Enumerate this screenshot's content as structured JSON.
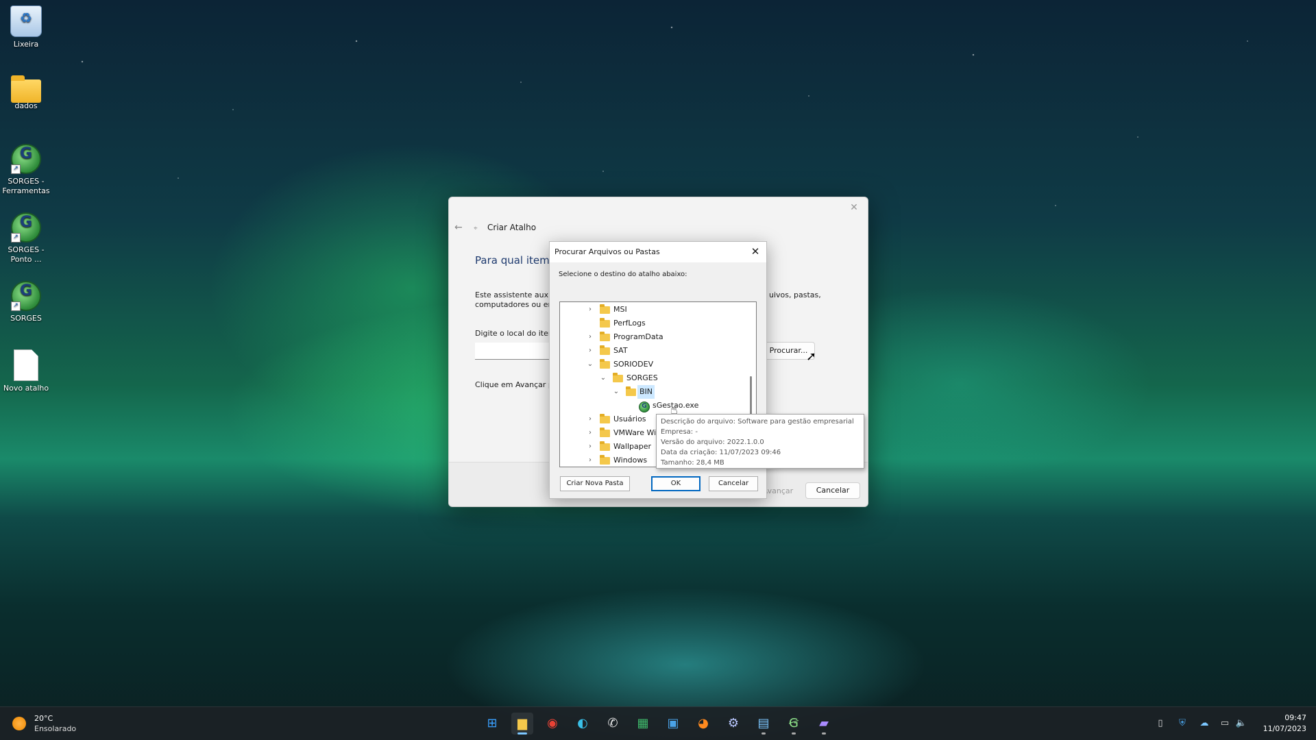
{
  "desktop": {
    "icons": [
      {
        "label": "Lixeira"
      },
      {
        "label": "dados"
      },
      {
        "label": "SORGES - Ferramentas"
      },
      {
        "label": "SORGES - Ponto ..."
      },
      {
        "label": "SORGES"
      },
      {
        "label": "Novo atalho"
      }
    ]
  },
  "wizard": {
    "title": "Criar Atalho",
    "heading": "Para qual item v",
    "description": "Este assistente auxili\ncomputadores ou en",
    "description_right": "uivos, pastas,",
    "location_label": "Digite o local do iten",
    "location_value": "",
    "browse_label": "Procurar...",
    "instruction": "Clique em Avançar p",
    "next_label": "Avançar",
    "cancel_label": "Cancelar"
  },
  "browse_dialog": {
    "title": "Procurar Arquivos ou Pastas",
    "prompt": "Selecione o destino do atalho abaixo:",
    "tree": [
      {
        "label": "MSI",
        "indent": 0,
        "expander": "collapsed",
        "type": "folder"
      },
      {
        "label": "PerfLogs",
        "indent": 0,
        "expander": "none",
        "type": "folder"
      },
      {
        "label": "ProgramData",
        "indent": 0,
        "expander": "collapsed",
        "type": "folder"
      },
      {
        "label": "SAT",
        "indent": 0,
        "expander": "collapsed",
        "type": "folder"
      },
      {
        "label": "SORIODEV",
        "indent": 0,
        "expander": "expanded",
        "type": "folder"
      },
      {
        "label": "SORGES",
        "indent": 1,
        "expander": "expanded",
        "type": "folder"
      },
      {
        "label": "BIN",
        "indent": 2,
        "expander": "expanded",
        "type": "folder",
        "selected": true
      },
      {
        "label": "sGestao.exe",
        "indent": 3,
        "expander": "none",
        "type": "exe"
      },
      {
        "label": "Usuários",
        "indent": 0,
        "expander": "collapsed",
        "type": "folder"
      },
      {
        "label": "VMWare Wi",
        "indent": 0,
        "expander": "collapsed",
        "type": "folder"
      },
      {
        "label": "Wallpaper",
        "indent": 0,
        "expander": "collapsed",
        "type": "folder"
      },
      {
        "label": "Windows",
        "indent": 0,
        "expander": "collapsed",
        "type": "folder"
      }
    ],
    "new_folder_label": "Criar Nova Pasta",
    "ok_label": "OK",
    "cancel_label": "Cancelar"
  },
  "tooltip": {
    "lines": [
      "Descrição do arquivo: Software para gestão empresarial",
      "Empresa: -",
      "Versão do arquivo: 2022.1.0.0",
      "Data da criação: 11/07/2023 09:46",
      "Tamanho: 28,4 MB"
    ]
  },
  "taskbar": {
    "weather_temp": "20°C",
    "weather_condition": "Ensolarado",
    "time": "09:47",
    "date": "11/07/2023",
    "apps": [
      {
        "icon": "windows-start-icon",
        "state": "none"
      },
      {
        "icon": "file-explorer-icon",
        "state": "active"
      },
      {
        "icon": "chrome-icon",
        "state": "none"
      },
      {
        "icon": "edge-icon",
        "state": "none"
      },
      {
        "icon": "whatsapp-icon",
        "state": "none"
      },
      {
        "icon": "spreadsheet-icon",
        "state": "none"
      },
      {
        "icon": "remote-desktop-icon",
        "state": "none"
      },
      {
        "icon": "firefox-icon",
        "state": "none"
      },
      {
        "icon": "settings-icon",
        "state": "none"
      },
      {
        "icon": "notepad-icon",
        "state": "open"
      },
      {
        "icon": "sorges-icon",
        "state": "open"
      },
      {
        "icon": "clipchamp-icon",
        "state": "open"
      }
    ]
  }
}
